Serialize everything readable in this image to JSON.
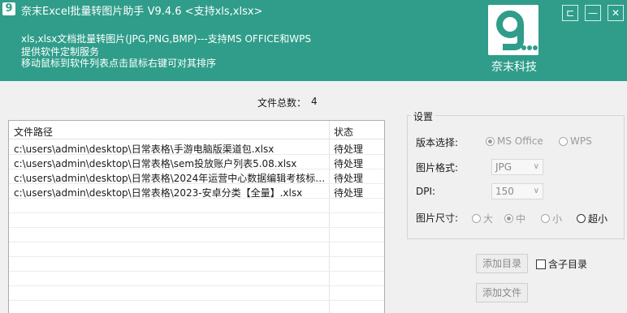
{
  "header": {
    "app_icon": "9",
    "title": "奈末Excel批量转图片助手    V9.4.6   <支持xls,xlsx>",
    "desc_1": "xls,xlsx文档批量转图片(JPG,PNG,BMP)---支持MS  OFFICE和WPS",
    "desc_2": "提供软件定制服务",
    "desc_3": "移动鼠标到软件列表点击鼠标右键可对其排序",
    "brand_name": "奈末科技",
    "window_buttons": {
      "pin": "⊏",
      "min": "—",
      "close": "✕"
    }
  },
  "summary": {
    "label": "文件总数：",
    "value": "4"
  },
  "file_list": {
    "headers": {
      "path": "文件路径",
      "status": "状态"
    },
    "rows": [
      {
        "path": "c:\\users\\admin\\desktop\\日常表格\\手游电脑版渠道包.xlsx",
        "status": "待处理"
      },
      {
        "path": "c:\\users\\admin\\desktop\\日常表格\\sem投放账户列表5.08.xlsx",
        "status": "待处理"
      },
      {
        "path": "c:\\users\\admin\\desktop\\日常表格\\2024年运营中心数据编辑考核标准...",
        "status": "待处理"
      },
      {
        "path": "c:\\users\\admin\\desktop\\日常表格\\2023-安卓分类【全量】.xlsx",
        "status": "待处理"
      }
    ]
  },
  "settings": {
    "legend": "设置",
    "version_label": "版本选择:",
    "version_options": [
      "MS Office",
      "WPS"
    ],
    "format_label": "图片格式:",
    "format_value": "JPG",
    "dpi_label": "DPI:",
    "dpi_value": "150",
    "size_label": "图片尺寸:",
    "size_options": [
      "大",
      "中",
      "小",
      "超小"
    ]
  },
  "actions": {
    "add_dir": "添加目录",
    "include_subdir": "含子目录",
    "add_file": "添加文件"
  },
  "colors": {
    "header_bg": "#2f9d8a",
    "brand_green": "#2f9d8a"
  }
}
